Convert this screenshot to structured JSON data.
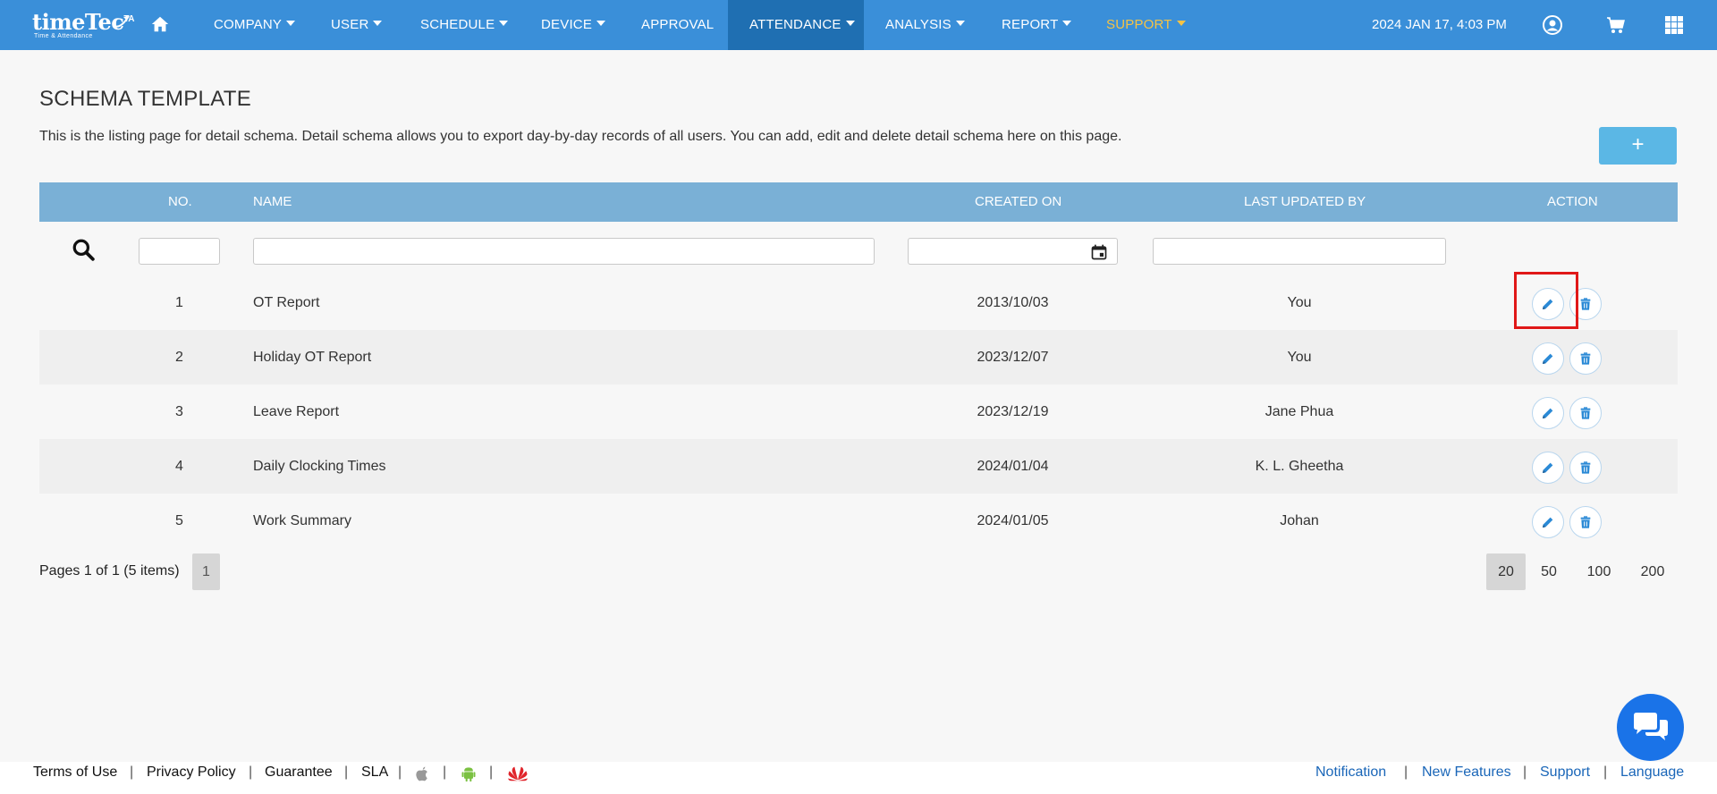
{
  "app": {
    "logo_text": "timeTec",
    "logo_sup": "TA",
    "logo_tagline": "Time & Attendance",
    "datetime": "2024 JAN 17, 4:03 PM"
  },
  "nav": {
    "items": [
      {
        "label": "COMPANY",
        "dropdown": true
      },
      {
        "label": "USER",
        "dropdown": true
      },
      {
        "label": "SCHEDULE",
        "dropdown": true
      },
      {
        "label": "DEVICE",
        "dropdown": true
      },
      {
        "label": "APPROVAL",
        "dropdown": false
      },
      {
        "label": "ATTENDANCE",
        "dropdown": true,
        "active": true
      },
      {
        "label": "ANALYSIS",
        "dropdown": true
      },
      {
        "label": "REPORT",
        "dropdown": true
      },
      {
        "label": "SUPPORT",
        "dropdown": true,
        "highlight_color": "#f6c344"
      }
    ],
    "right_icons": [
      "user-circle-icon",
      "cart-icon",
      "apps-grid-icon"
    ]
  },
  "page": {
    "title": "SCHEMA TEMPLATE",
    "description": "This is the listing page for detail schema. Detail schema allows you to export day-by-day records of all users. You can add, edit and delete detail schema here on this page.",
    "add_label": "+"
  },
  "table": {
    "columns": [
      "NO.",
      "NAME",
      "CREATED ON",
      "LAST UPDATED BY",
      "ACTION"
    ],
    "rows": [
      {
        "no": "1",
        "name": "OT Report",
        "created": "2013/10/03",
        "updated_by": "You"
      },
      {
        "no": "2",
        "name": "Holiday OT Report",
        "created": "2023/12/07",
        "updated_by": "You"
      },
      {
        "no": "3",
        "name": "Leave Report",
        "created": "2023/12/19",
        "updated_by": "Jane Phua"
      },
      {
        "no": "4",
        "name": "Daily Clocking Times",
        "created": "2024/01/04",
        "updated_by": "K. L. Gheetha"
      },
      {
        "no": "5",
        "name": "Work Summary",
        "created": "2024/01/05",
        "updated_by": "Johan"
      }
    ]
  },
  "pager": {
    "info": "Pages 1 of 1 (5 items)",
    "current_page": "1",
    "sizes": [
      "20",
      "50",
      "100",
      "200"
    ],
    "selected_size": "20"
  },
  "footer": {
    "left": [
      "Terms of Use",
      "Privacy Policy",
      "Guarantee",
      "SLA"
    ],
    "right": [
      "Notification",
      "New Features",
      "Support",
      "Language"
    ],
    "separator": "|"
  },
  "colors": {
    "nav_bg": "#3a8fd9",
    "nav_active": "#1f6fb2",
    "table_header": "#7ab0d6",
    "accent": "#1a66b8",
    "highlight_box": "#e01818"
  }
}
